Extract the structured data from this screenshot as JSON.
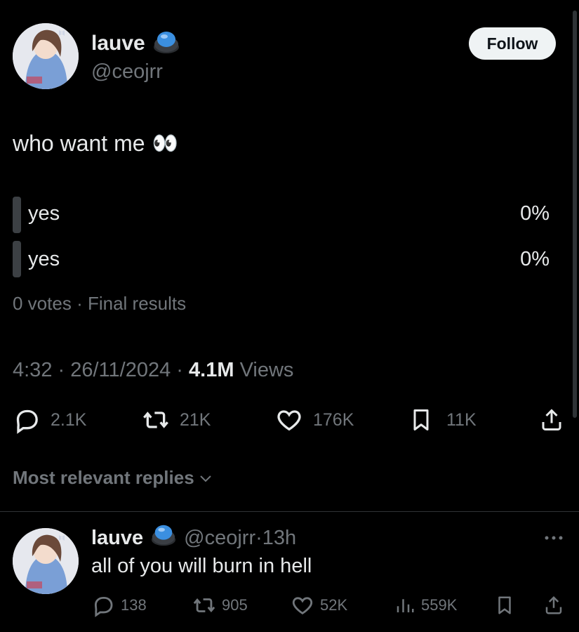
{
  "post": {
    "author": {
      "name": "lauve",
      "handle": "@ceojrr"
    },
    "follow_label": "Follow",
    "text": "who want me",
    "text_emoji": "👀",
    "poll": {
      "options": [
        {
          "label": "yes",
          "percent": "0%"
        },
        {
          "label": "yes",
          "percent": "0%"
        }
      ],
      "votes": "0 votes",
      "status": "Final results"
    },
    "time": "4:32",
    "date": "26/11/2024",
    "views_count": "4.1M",
    "views_label": "Views",
    "actions": {
      "replies": "2.1K",
      "reposts": "21K",
      "likes": "176K",
      "bookmarks": "11K"
    }
  },
  "replies_sort_label": "Most relevant replies",
  "reply": {
    "author": {
      "name": "lauve",
      "handle": "@ceojrr",
      "time": "13h"
    },
    "text": "all of you will burn in hell",
    "actions": {
      "replies": "138",
      "reposts": "905",
      "likes": "52K",
      "views": "559K"
    }
  },
  "colors": {
    "background": "#000000",
    "text": "#e7e9ea",
    "muted": "#71767b",
    "badge": "#3b8fe0"
  }
}
